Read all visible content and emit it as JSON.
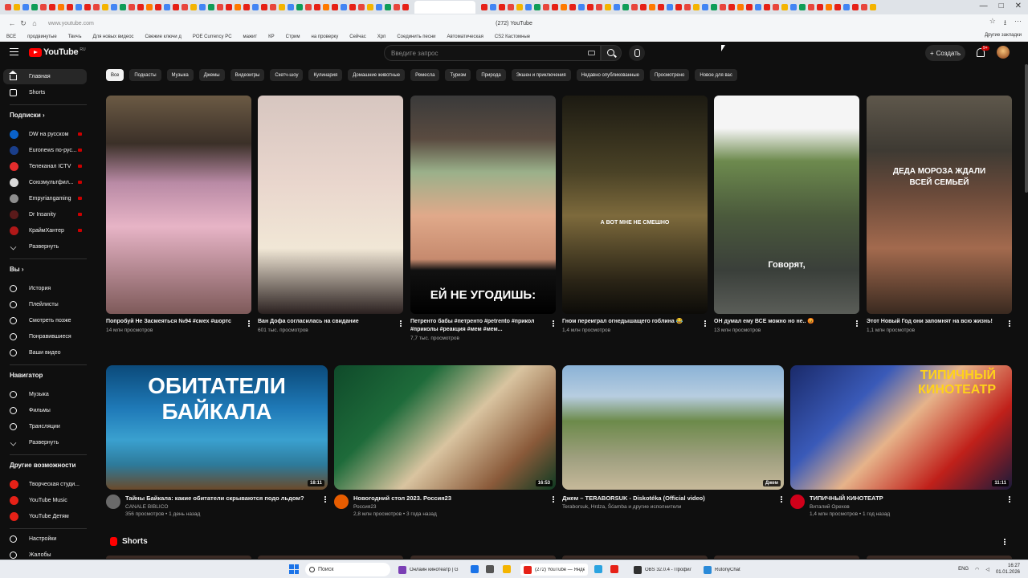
{
  "browser": {
    "page_title": "(272) YouTube",
    "url": "www.youtube.com",
    "bookmarks": [
      "ВСЕ",
      "продвинутые",
      "Твичъ",
      "Для новых видеос",
      "Свежие ключи д",
      "POE Currency PC",
      "мажит",
      "КР",
      "Стрим",
      "на проверку",
      "Сейчас",
      "Хрп",
      "Соединить песни",
      "Автоматическая",
      "CS2 Кастомные"
    ],
    "bookmarks_right": "Другие закладки"
  },
  "header": {
    "logo_text": "YouTube",
    "logo_region": "RU",
    "search_placeholder": "Введите запрос",
    "create_label": "Создать",
    "notif_count": "9+"
  },
  "sidebar": {
    "main": [
      {
        "label": "Главная",
        "icon": "home-icon",
        "active": true
      },
      {
        "label": "Shorts",
        "icon": "shorts-icon",
        "active": false
      }
    ],
    "subs_head": "Подписки",
    "subs": [
      {
        "label": "DW на русском",
        "color": "#0a62c9"
      },
      {
        "label": "Euronews по-рус...",
        "color": "#1a3e8a"
      },
      {
        "label": "Телеканал ICTV",
        "color": "#e32d2d"
      },
      {
        "label": "Союзмультфил...",
        "color": "#d9d9d9"
      },
      {
        "label": "Empyriangaming",
        "color": "#8e8e8e"
      },
      {
        "label": "Dr Insanity",
        "color": "#5a1a1a"
      },
      {
        "label": "КраймХантер",
        "color": "#b01818"
      }
    ],
    "subs_expand": "Развернуть",
    "you_head": "Вы",
    "you": [
      {
        "label": "История",
        "icon": "history-icon"
      },
      {
        "label": "Плейлисты",
        "icon": "playlist-icon"
      },
      {
        "label": "Смотреть позже",
        "icon": "clock-icon"
      },
      {
        "label": "Понравившиеся",
        "icon": "thumb-up-icon"
      },
      {
        "label": "Ваши видео",
        "icon": "your-videos-icon"
      }
    ],
    "nav_head": "Навигатор",
    "nav": [
      {
        "label": "Музыка",
        "icon": "music-icon"
      },
      {
        "label": "Фильмы",
        "icon": "film-icon"
      },
      {
        "label": "Трансляции",
        "icon": "live-icon"
      },
      {
        "label": "Развернуть",
        "icon": "chevron-down-icon"
      }
    ],
    "other_head": "Другие возможности",
    "other": [
      {
        "label": "Творческая студи...",
        "color": "#e62117"
      },
      {
        "label": "YouTube Music",
        "color": "#e62117"
      },
      {
        "label": "YouTube Детям",
        "color": "#e62117"
      }
    ],
    "settings": [
      {
        "label": "Настройки",
        "icon": "gear-icon"
      },
      {
        "label": "Жалобы",
        "icon": "flag-icon"
      }
    ]
  },
  "chips": [
    "Все",
    "Подкасты",
    "Музыка",
    "Джемы",
    "Видеоигры",
    "Скетч-шоу",
    "Кулинария",
    "Домашние животные",
    "Ремесла",
    "Туризм",
    "Природа",
    "Экшен и приключения",
    "Недавно опубликованные",
    "Просмотрено",
    "Новое для вас"
  ],
  "shorts_row": [
    {
      "title": "Попробуй Не Засмеяться №94 #смех #шортс",
      "views": "14 млн просмотров",
      "caption": "",
      "bg": "linear-gradient(180deg,#6b5a44 0%,#3b3028 22%,#b98aa5 40%,#e7b4c6 60%,#7e5a5a 100%)"
    },
    {
      "title": "Ван Дофа согласилась на свидание",
      "views": "601 тыс. просмотров",
      "caption": "",
      "bg": "linear-gradient(180deg,#d7c6c0 0%,#e9d6cd 40%,#f1e7d6 70%,#2b2120 100%)"
    },
    {
      "title": "Петренто бабы #петренто #petrento #прикол #приколы #реакция #мем #мем...",
      "views": "7,7 тыс. просмотров",
      "caption": "ЕЙ НЕ УГОДИШЬ:",
      "bg": "linear-gradient(180deg,#3a3a3a 0%,#5a4b40 20%,#9ab08a 35%,#e0a98a 55%,#c68a6e 75%,#111 80%,#000 100%)"
    },
    {
      "title": "Гном переиграл огнедышащего гоблина 😂",
      "views": "1,4 млн просмотров",
      "caption": "А ВОТ МНЕ НЕ СМЕШНО",
      "bg": "linear-gradient(180deg,#1c1a12 0%,#4a4226 35%,#7d6a3c 55%,#2a2416 85%,#0c0b08 100%)"
    },
    {
      "title": "ОН думал ему ВСЕ можно но не.. 😡",
      "views": "13 млн просмотров",
      "caption": "Говорят,",
      "bg": "linear-gradient(180deg,#f5f5f5 0%,#f5f5f5 15%,#6d8a4e 30%,#4b5a3c 55%,#3a3f3a 80%,#5a5d58 100%)"
    },
    {
      "title": "Этот Новый Год они запомнят на всю жизнь!",
      "views": "1,1 млн просмотров",
      "caption": "ДЕДА МОРОЗА ЖДАЛИ ВСЕЙ СЕМЬЕЙ",
      "bg": "linear-gradient(180deg,#5e574b 0%,#3e3a33 25%,#6a4a3a 45%,#a36a4e 70%,#3a2a20 100%)"
    }
  ],
  "videos_row": [
    {
      "title": "Тайны Байкала: какие обитатели скрываются подо льдом?",
      "channel": "CANALE BIBLICO",
      "meta": "356 просмотров • 1 день назад",
      "duration": "18:11",
      "caption": "ОБИТАТЕЛИ БАЙКАЛА",
      "av": "#6a6a6a",
      "bg": "linear-gradient(180deg,#0b4a7a 0%,#1f7ab8 35%,#3aa0cf 60%,#2d7a9a 80%,#6b4a2a 100%)"
    },
    {
      "title": "Новогодний стол 2023. Россия23",
      "channel": "Россия23",
      "meta": "2,8 млн просмотров • 3 года назад",
      "duration": "16:53",
      "caption": "",
      "av": "#e65c00",
      "bg": "linear-gradient(135deg,#0f4a2a 0%,#1e6b3a 30%,#d9c4a0 55%,#8a5a3a 80%,#0e3a22 100%)"
    },
    {
      "title": "Джем – TERABORSUK - Diskotéka (Official video)",
      "channel": "Teraborsuk, Hrdza, Šćamba и другие исполнители",
      "meta": "",
      "duration": "Джем",
      "caption": "",
      "av": "",
      "bg": "linear-gradient(180deg,#8ab2d6 0%,#b7cde0 25%,#6c8a4a 45%,#a0a080 75%,#c6b99a 100%)"
    },
    {
      "title": "ТИПИЧНЫЙ КИНОТЕАТР",
      "channel": "Виталий Орехов",
      "meta": "1,4 млн просмотров • 1 год назад",
      "duration": "11:11",
      "caption": "ТИПИЧНЫЙ КИНОТЕАТР",
      "av": "#d0001a",
      "bg": "linear-gradient(135deg,#1a2a6a 0%,#3a5ab8 30%,#e6b38a 50%,#c0201a 75%,#1a1a3a 100%)"
    }
  ],
  "shorts_section": "Shorts",
  "taskbar": {
    "search": "Поиск",
    "apps": [
      {
        "label": "Онлайн кинотеатр | GT",
        "active": false,
        "color": "#7b3fb5"
      },
      {
        "label": "(272) YouTube — Янде",
        "active": true,
        "color": "#e62117"
      },
      {
        "label": "OBS 32.0.4 - Профиль:",
        "active": false,
        "color": "#303030"
      },
      {
        "label": "RutonyChat",
        "active": false,
        "color": "#2a8ad8"
      }
    ],
    "lang": "ENG",
    "time": "16:27",
    "date": "01.01.2026"
  }
}
